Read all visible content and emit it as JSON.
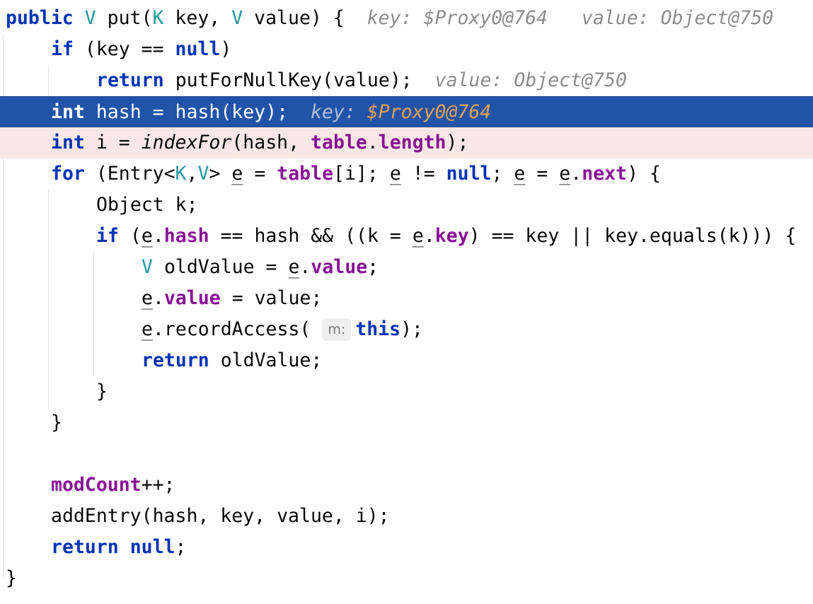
{
  "code": {
    "l1": {
      "t1": "public",
      "t2": "V",
      "t3": "put(",
      "t4": "K",
      "t5": "key,",
      "t6": "V",
      "t7": "value) {"
    },
    "l1_hints": {
      "key_label": "key:",
      "key_value": "$Proxy0@764",
      "value_label": "value:",
      "value_value": "Object@750"
    },
    "l2": {
      "t1": "if",
      "t2": "(key ==",
      "t3": "null",
      "t4": ")"
    },
    "l3": {
      "t1": "return",
      "t2": "putForNullKey(value);"
    },
    "l3_hints": {
      "value_label": "value:",
      "value_value": "Object@750"
    },
    "l4": {
      "t1": "int",
      "t2": "hash = hash(key);"
    },
    "l4_hints": {
      "key_label": "key:",
      "key_value": "$Proxy0@764"
    },
    "l5": {
      "t1": "int",
      "t2": "i =",
      "t3": "indexFor",
      "t4": "(hash,",
      "t5": "table",
      "t6": ".",
      "t7": "length",
      "t8": ");"
    },
    "l6": {
      "t1": "for",
      "t2": "(Entry<",
      "t3": "K",
      "t4": ",",
      "t5": "V",
      "t6": ">",
      "t7": "e",
      "t8": "=",
      "t9": "table",
      "t10": "[i];",
      "t11": "e",
      "t12": "!=",
      "t13": "null",
      "t14": ";",
      "t15": "e",
      "t16": "=",
      "t17": "e",
      "t18": ".",
      "t19": "next",
      "t20": ") {"
    },
    "l7": {
      "t1": "Object k;"
    },
    "l8": {
      "t1": "if",
      "t2": "(",
      "t3": "e",
      "t4": ".",
      "t5": "hash",
      "t6": "== hash && ((k =",
      "t7": "e",
      "t8": ".",
      "t9": "key",
      "t10": ") == key || key.equals(k))) {"
    },
    "l9": {
      "t1": "V",
      "t2": "oldValue =",
      "t3": "e",
      "t4": ".",
      "t5": "value",
      "t6": ";"
    },
    "l10": {
      "t1": "e",
      "t2": ".",
      "t3": "value",
      "t4": "= value;"
    },
    "l11": {
      "t1": "e",
      "t2": ".recordAccess(",
      "param_hint": "m:",
      "t3": "this",
      "t4": ");"
    },
    "l12": {
      "t1": "return",
      "t2": "oldValue;"
    },
    "l13": {
      "t1": "}"
    },
    "l14": {
      "t1": "}"
    },
    "l16": {
      "t1": "modCount",
      "t2": "++;"
    },
    "l17": {
      "t1": "addEntry(hash, key, value, i);"
    },
    "l18": {
      "t1": "return",
      "t2": "null",
      "t3": ";"
    },
    "l19": {
      "t1": "}"
    }
  }
}
